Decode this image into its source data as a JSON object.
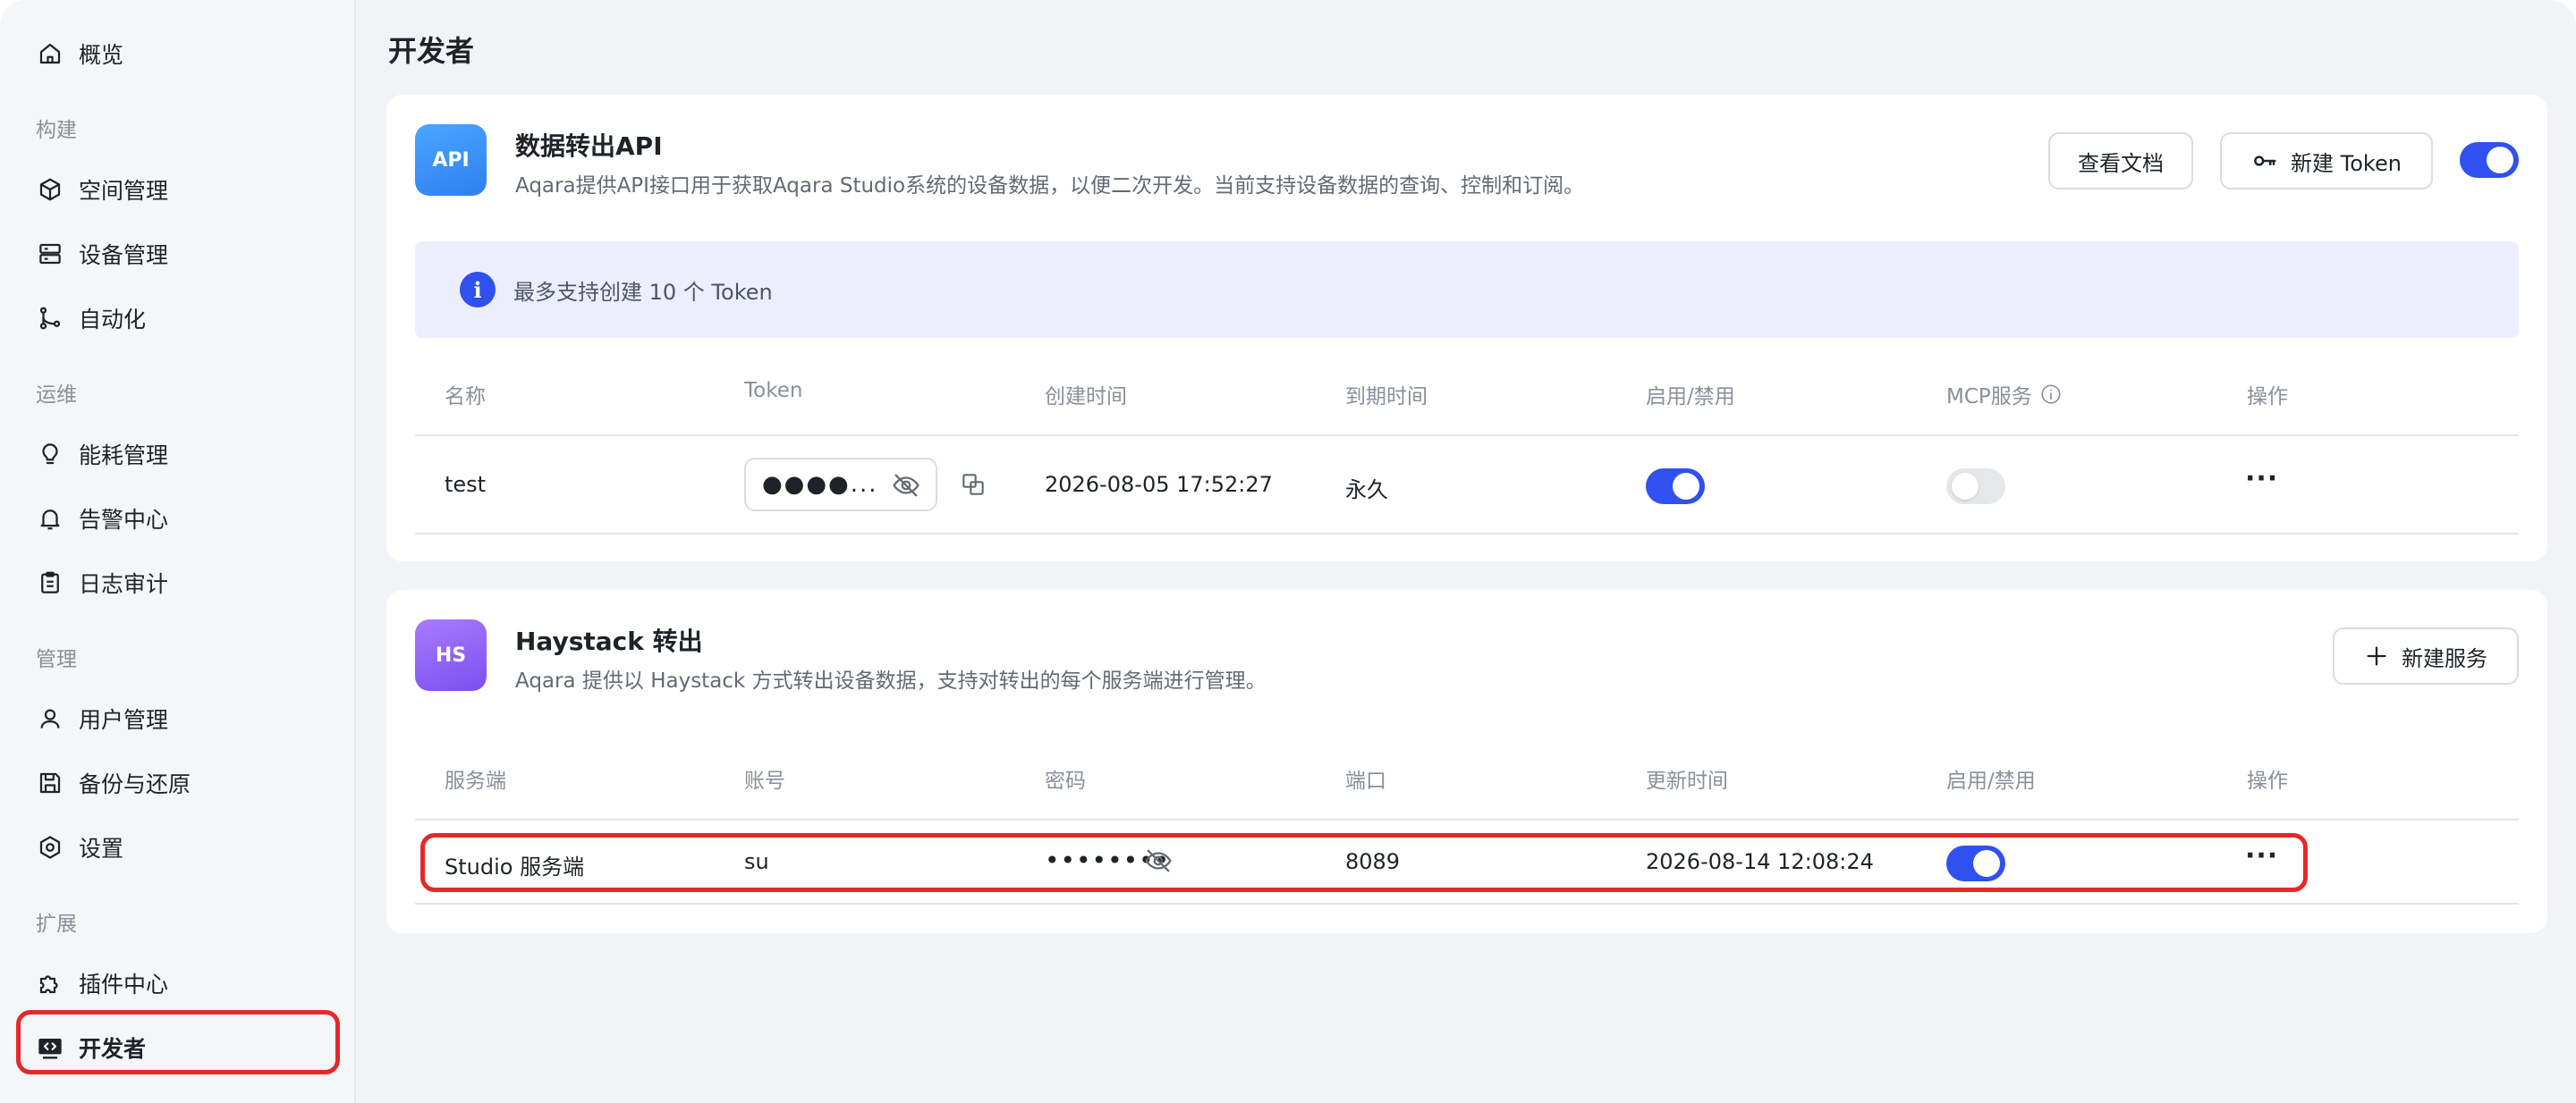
{
  "sidebar": {
    "overview": "概览",
    "groups": {
      "build": "构建",
      "ops": "运维",
      "manage": "管理",
      "extend": "扩展"
    },
    "items": {
      "space": "空间管理",
      "device": "设备管理",
      "automation": "自动化",
      "energy": "能耗管理",
      "alarm": "告警中心",
      "audit": "日志审计",
      "users": "用户管理",
      "backup": "备份与还原",
      "settings": "设置",
      "plugins": "插件中心",
      "developer": "开发者"
    }
  },
  "page": {
    "title": "开发者"
  },
  "api_card": {
    "icon_text": "API",
    "title": "数据转出API",
    "desc": "Aqara提供API接口用于获取Aqara Studio系统的设备数据，以便二次开发。当前支持设备数据的查询、控制和订阅。",
    "docs_button": "查看文档",
    "new_token_button": "新建 Token",
    "enabled": true,
    "banner": "最多支持创建 10 个 Token",
    "banner_icon": "i",
    "columns": [
      "名称",
      "Token",
      "创建时间",
      "到期时间",
      "启用/禁用",
      "MCP服务",
      "操作"
    ],
    "rows": [
      {
        "name": "test",
        "token_masked": "●●●●...",
        "created": "2026-08-05 17:52:27",
        "expires": "永久",
        "enabled": true,
        "mcp": false,
        "actions": "···"
      }
    ]
  },
  "haystack_card": {
    "icon_text": "HS",
    "title": "Haystack 转出",
    "desc": "Aqara 提供以 Haystack 方式转出设备数据，支持对转出的每个服务端进行管理。",
    "new_service_button": "新建服务",
    "columns": [
      "服务端",
      "账号",
      "密码",
      "端口",
      "更新时间",
      "启用/禁用",
      "操作"
    ],
    "rows": [
      {
        "server": "Studio 服务端",
        "account": "su",
        "password_masked": "••••••••",
        "port": "8089",
        "updated": "2026-08-14 12:08:24",
        "enabled": true,
        "actions": "···"
      }
    ]
  },
  "colors": {
    "accent": "#3050f0",
    "highlight": "#e5292b",
    "api_icon_bg": "#2f8df5",
    "hs_icon_bg": "#8a5cf6"
  }
}
